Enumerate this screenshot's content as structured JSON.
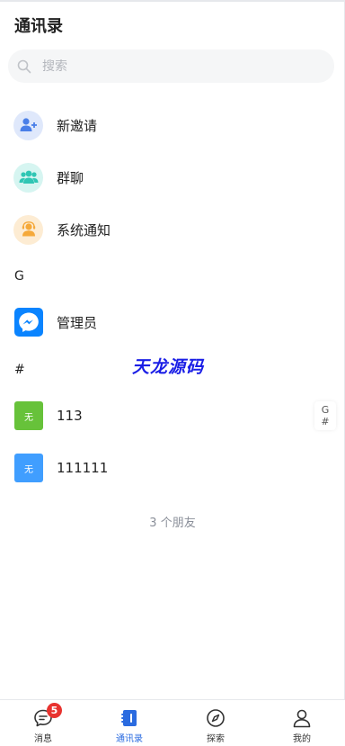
{
  "header": {
    "title": "通讯录"
  },
  "search": {
    "placeholder": "搜索",
    "icon": "search-icon"
  },
  "special_items": [
    {
      "label": "新邀请",
      "icon": "add-user-icon",
      "color": "#4a7fe8"
    },
    {
      "label": "群聊",
      "icon": "group-icon",
      "color": "#2fc6b4"
    },
    {
      "label": "系统通知",
      "icon": "notification-icon",
      "color": "#f5a93a"
    }
  ],
  "sections": [
    {
      "letter": "G",
      "contacts": [
        {
          "name": "管理员",
          "avatar": "messenger-icon",
          "avatar_color": "#0a84ff"
        }
      ]
    },
    {
      "letter": "#",
      "contacts": [
        {
          "name": "113",
          "avatar_text": "无",
          "avatar_color": "#67c23a"
        },
        {
          "name": "111111",
          "avatar_text": "无",
          "avatar_color": "#409eff"
        }
      ]
    }
  ],
  "watermark": "天龙源码",
  "index_bar": [
    "G",
    "#"
  ],
  "friend_count": "3 个朋友",
  "tabbar": {
    "active": "contacts",
    "tabs": [
      {
        "label": "消息",
        "icon": "message-icon",
        "badge": "5"
      },
      {
        "label": "通讯录",
        "icon": "contacts-icon"
      },
      {
        "label": "探索",
        "icon": "compass-icon"
      },
      {
        "label": "我的",
        "icon": "user-icon"
      }
    ]
  }
}
